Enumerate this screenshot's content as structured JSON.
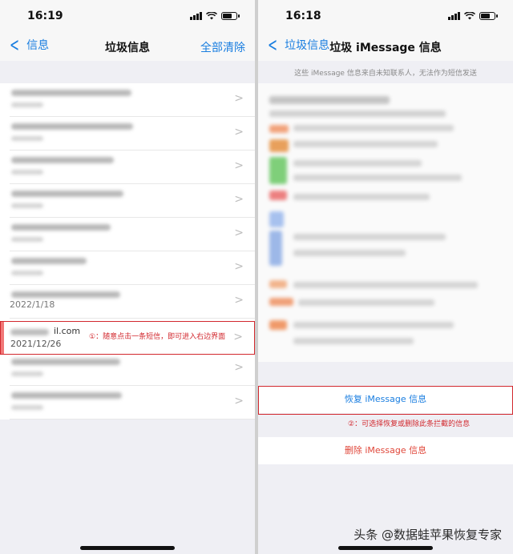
{
  "left": {
    "time": "16:19",
    "back_label": "信息",
    "title": "垃圾信息",
    "action": "全部清除",
    "rows": [
      {
        "date": ""
      },
      {
        "date": ""
      },
      {
        "date": ""
      },
      {
        "date": ""
      },
      {
        "date": ""
      },
      {
        "date": ""
      },
      {
        "date": "2022/1/18"
      }
    ],
    "highlight_row": {
      "email_suffix": "il.com",
      "date": "2021/12/26",
      "annotation": "①：随意点击一条短信，即可进入右边界面"
    }
  },
  "right": {
    "time": "16:18",
    "back_label": "垃圾信息",
    "title": "垃圾 iMessage 信息",
    "notice": "这些 iMessage 信息来自未知联系人，无法作为短信发送",
    "restore_label": "恢复 iMessage 信息",
    "delete_label": "删除 iMessage 信息",
    "annotation": "②：可选择恢复或删除此条拦截的信息",
    "watermark": "头条 @数据蛙苹果恢复专家"
  },
  "colors": {
    "accent_blue": "#1a7ee0",
    "annotation_red": "#d2282e",
    "delete_red": "#e0473a"
  }
}
